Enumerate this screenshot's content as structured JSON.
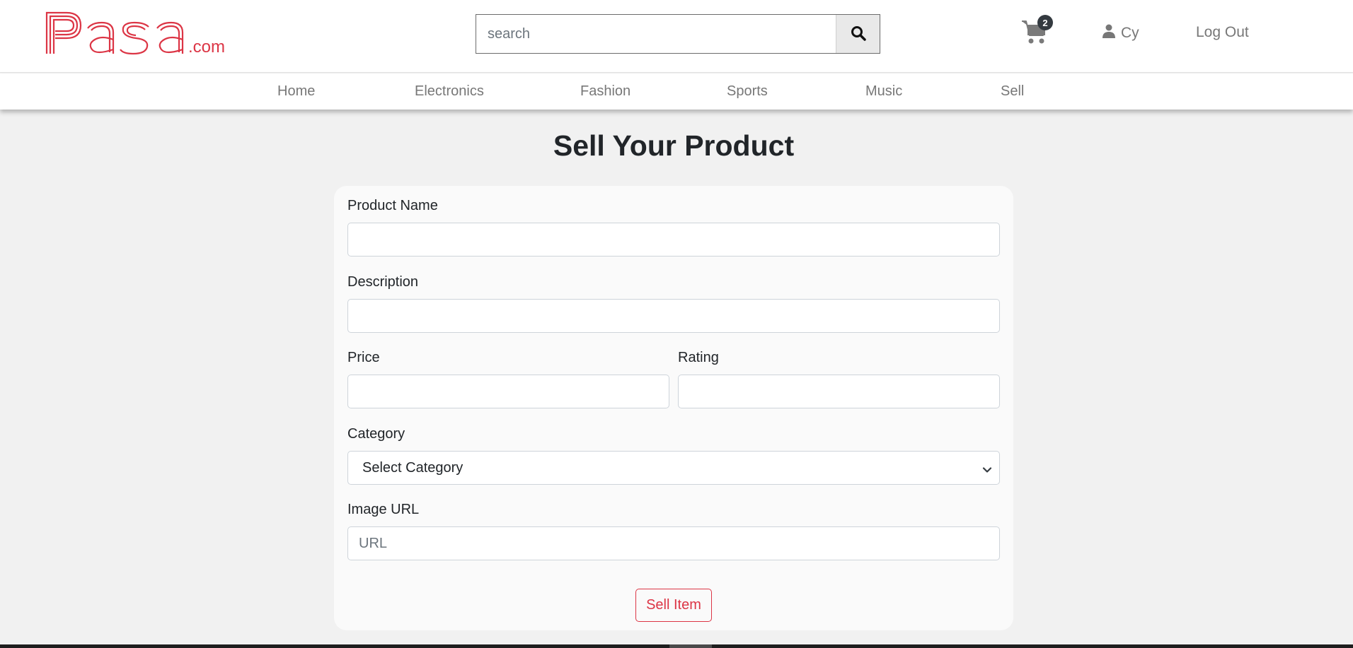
{
  "header": {
    "logo_text": "Pasa",
    "logo_suffix": ".com",
    "search_placeholder": "search",
    "cart_count": "2",
    "user_name": "Cy",
    "logout_label": "Log Out"
  },
  "nav": {
    "items": [
      {
        "label": "Home"
      },
      {
        "label": "Electronics"
      },
      {
        "label": "Fashion"
      },
      {
        "label": "Sports"
      },
      {
        "label": "Music"
      },
      {
        "label": "Sell"
      }
    ]
  },
  "main": {
    "title": "Sell Your Product",
    "form": {
      "product_name_label": "Product Name",
      "product_name_value": "",
      "description_label": "Description",
      "description_value": "",
      "price_label": "Price",
      "price_value": "",
      "rating_label": "Rating",
      "rating_value": "",
      "category_label": "Category",
      "category_selected": "Select Category",
      "image_url_label": "Image URL",
      "image_url_placeholder": "URL",
      "submit_label": "Sell Item"
    }
  },
  "colors": {
    "brand": "#dc3545",
    "background": "#f1f1f1",
    "card": "#fafafa",
    "nav_text": "#777777"
  },
  "icons": {
    "search": "search-icon",
    "cart": "cart-icon",
    "user": "user-icon",
    "chevron": "chevron-down-icon"
  }
}
